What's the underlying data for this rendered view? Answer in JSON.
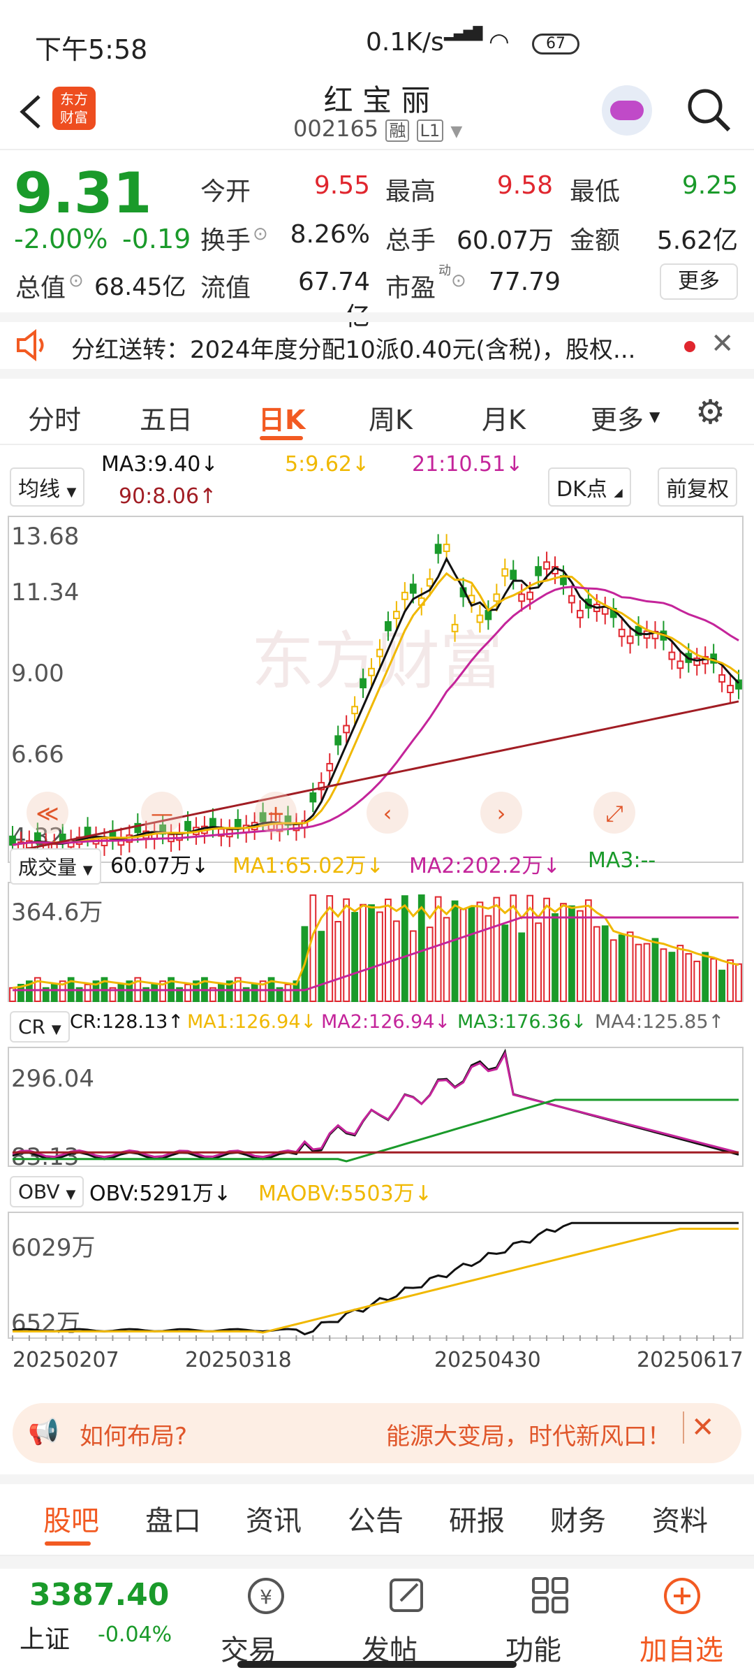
{
  "status": {
    "time": "下午5:58",
    "net": "0.1K/s",
    "battery": "67"
  },
  "nav": {
    "title": "红 宝 丽",
    "code": "002165",
    "tag1": "融",
    "tag2": "L1",
    "logo_line1": "东方",
    "logo_line2": "财富"
  },
  "quote": {
    "price": "9.31",
    "change_pct": "-2.00%",
    "change": "-0.19",
    "open_label": "今开",
    "open": "9.55",
    "high_label": "最高",
    "high": "9.58",
    "low_label": "最低",
    "low": "9.25",
    "turnover_label": "换手",
    "turnover": "8.26%",
    "volume_label": "总手",
    "volume": "60.07万",
    "amount_label": "金额",
    "amount": "5.62亿",
    "mcap_label": "总值",
    "mcap": "68.45亿",
    "float_label": "流值",
    "float": "67.74亿",
    "pe_label": "市盈",
    "pe_sup": "动",
    "pe": "77.79",
    "more": "更多"
  },
  "notice": {
    "text": "分红送转：2024年度分配10派0.40元(含税)，股权..."
  },
  "tabs": [
    "分时",
    "五日",
    "日K",
    "周K",
    "月K",
    "更多"
  ],
  "active_tab": 2,
  "kline": {
    "ma_select": "均线",
    "ma3": "MA3:9.40",
    "ma5": "5:9.62",
    "ma21": "21:10.51",
    "ma90": "90:8.06",
    "dk": "DK点",
    "adj": "前复权",
    "y_ticks": [
      "13.68",
      "11.34",
      "9.00",
      "6.66",
      "4.32"
    ],
    "watermark": "东方财富"
  },
  "volume": {
    "select": "成交量",
    "v": "60.07万",
    "ma1": "MA1:65.02万",
    "ma2": "MA2:202.2万",
    "ma3": "MA3:--",
    "top": "364.6万"
  },
  "cr": {
    "select": "CR",
    "cr": "CR:128.13",
    "ma1": "MA1:126.94",
    "ma2": "MA2:126.94",
    "ma3": "MA3:176.36",
    "ma4": "MA4:125.85",
    "top": "296.04",
    "bottom": "83.13"
  },
  "obv": {
    "select": "OBV",
    "obv": "OBV:5291万",
    "maobv": "MAOBV:5503万",
    "top": "6029万",
    "bottom": "652万"
  },
  "dates": [
    "20250207",
    "20250318",
    "20250430",
    "20250617"
  ],
  "promo": {
    "left": "如何布局?",
    "right": "能源大变局，时代新风口！"
  },
  "bottom_tabs": [
    "股吧",
    "盘口",
    "资讯",
    "公告",
    "研报",
    "财务",
    "资料"
  ],
  "index": {
    "value": "3387.40",
    "name": "上证",
    "change": "-0.04%"
  },
  "bottom_nav": [
    "交易",
    "发帖",
    "功能",
    "加自选"
  ],
  "colors": {
    "up": "#e0262e",
    "down": "#1a9a2a",
    "ma3": "#111111",
    "ma5": "#f0b800",
    "ma21": "#c4249a",
    "ma90": "#a11d24",
    "accent": "#f25a22"
  }
}
